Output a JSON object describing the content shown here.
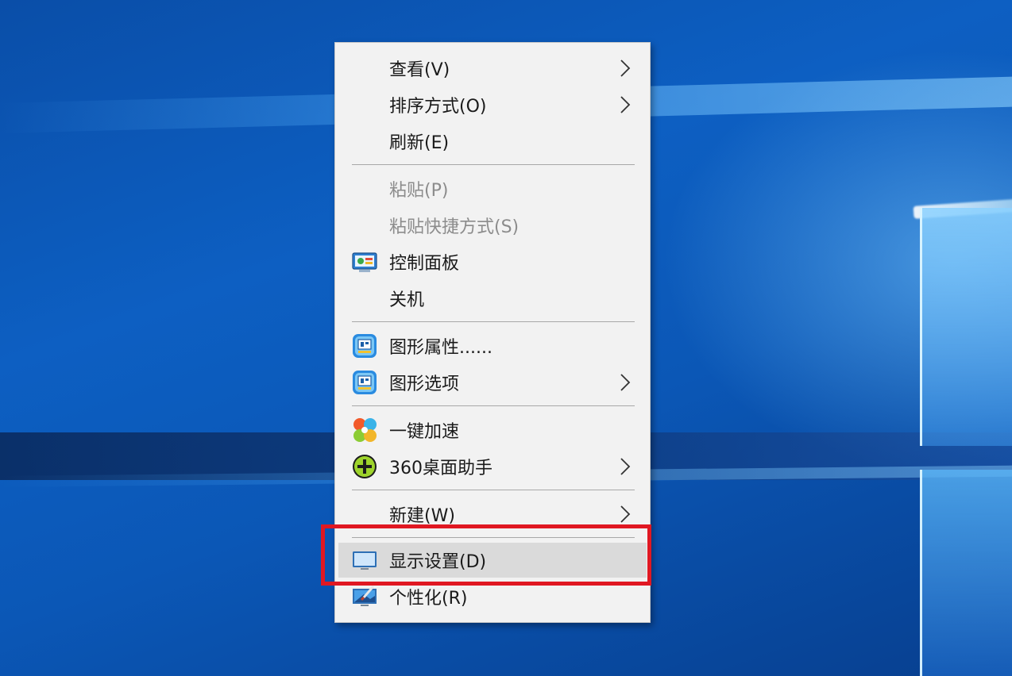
{
  "context_menu": {
    "items": [
      {
        "label": "查看(V)",
        "has_submenu": true,
        "icon": "",
        "enabled": true
      },
      {
        "label": "排序方式(O)",
        "has_submenu": true,
        "icon": "",
        "enabled": true
      },
      {
        "label": "刷新(E)",
        "has_submenu": false,
        "icon": "",
        "enabled": true
      },
      {
        "label": "粘贴(P)",
        "has_submenu": false,
        "icon": "",
        "enabled": false
      },
      {
        "label": "粘贴快捷方式(S)",
        "has_submenu": false,
        "icon": "",
        "enabled": false
      },
      {
        "label": "控制面板",
        "has_submenu": false,
        "icon": "control-panel-icon",
        "enabled": true
      },
      {
        "label": "关机",
        "has_submenu": false,
        "icon": "",
        "enabled": true
      },
      {
        "label": "图形属性......",
        "has_submenu": false,
        "icon": "intel-graphics-icon",
        "enabled": true
      },
      {
        "label": "图形选项",
        "has_submenu": true,
        "icon": "intel-graphics-icon",
        "enabled": true
      },
      {
        "label": "一键加速",
        "has_submenu": false,
        "icon": "pinwheel-accelerate-icon",
        "enabled": true
      },
      {
        "label": "360桌面助手",
        "has_submenu": true,
        "icon": "360-plus-icon",
        "enabled": true
      },
      {
        "label": "新建(W)",
        "has_submenu": true,
        "icon": "",
        "enabled": true
      },
      {
        "label": "显示设置(D)",
        "has_submenu": false,
        "icon": "display-monitor-icon",
        "enabled": true,
        "highlighted": true
      },
      {
        "label": "个性化(R)",
        "has_submenu": false,
        "icon": "personalize-paintbrush-icon",
        "enabled": true
      }
    ]
  },
  "colors": {
    "menu_background": "#f2f2f2",
    "highlight_background": "#dadada",
    "disabled_text": "#8c8c8c",
    "annotation_red": "#e01822",
    "desktop_blue": "#0d5fc2"
  }
}
